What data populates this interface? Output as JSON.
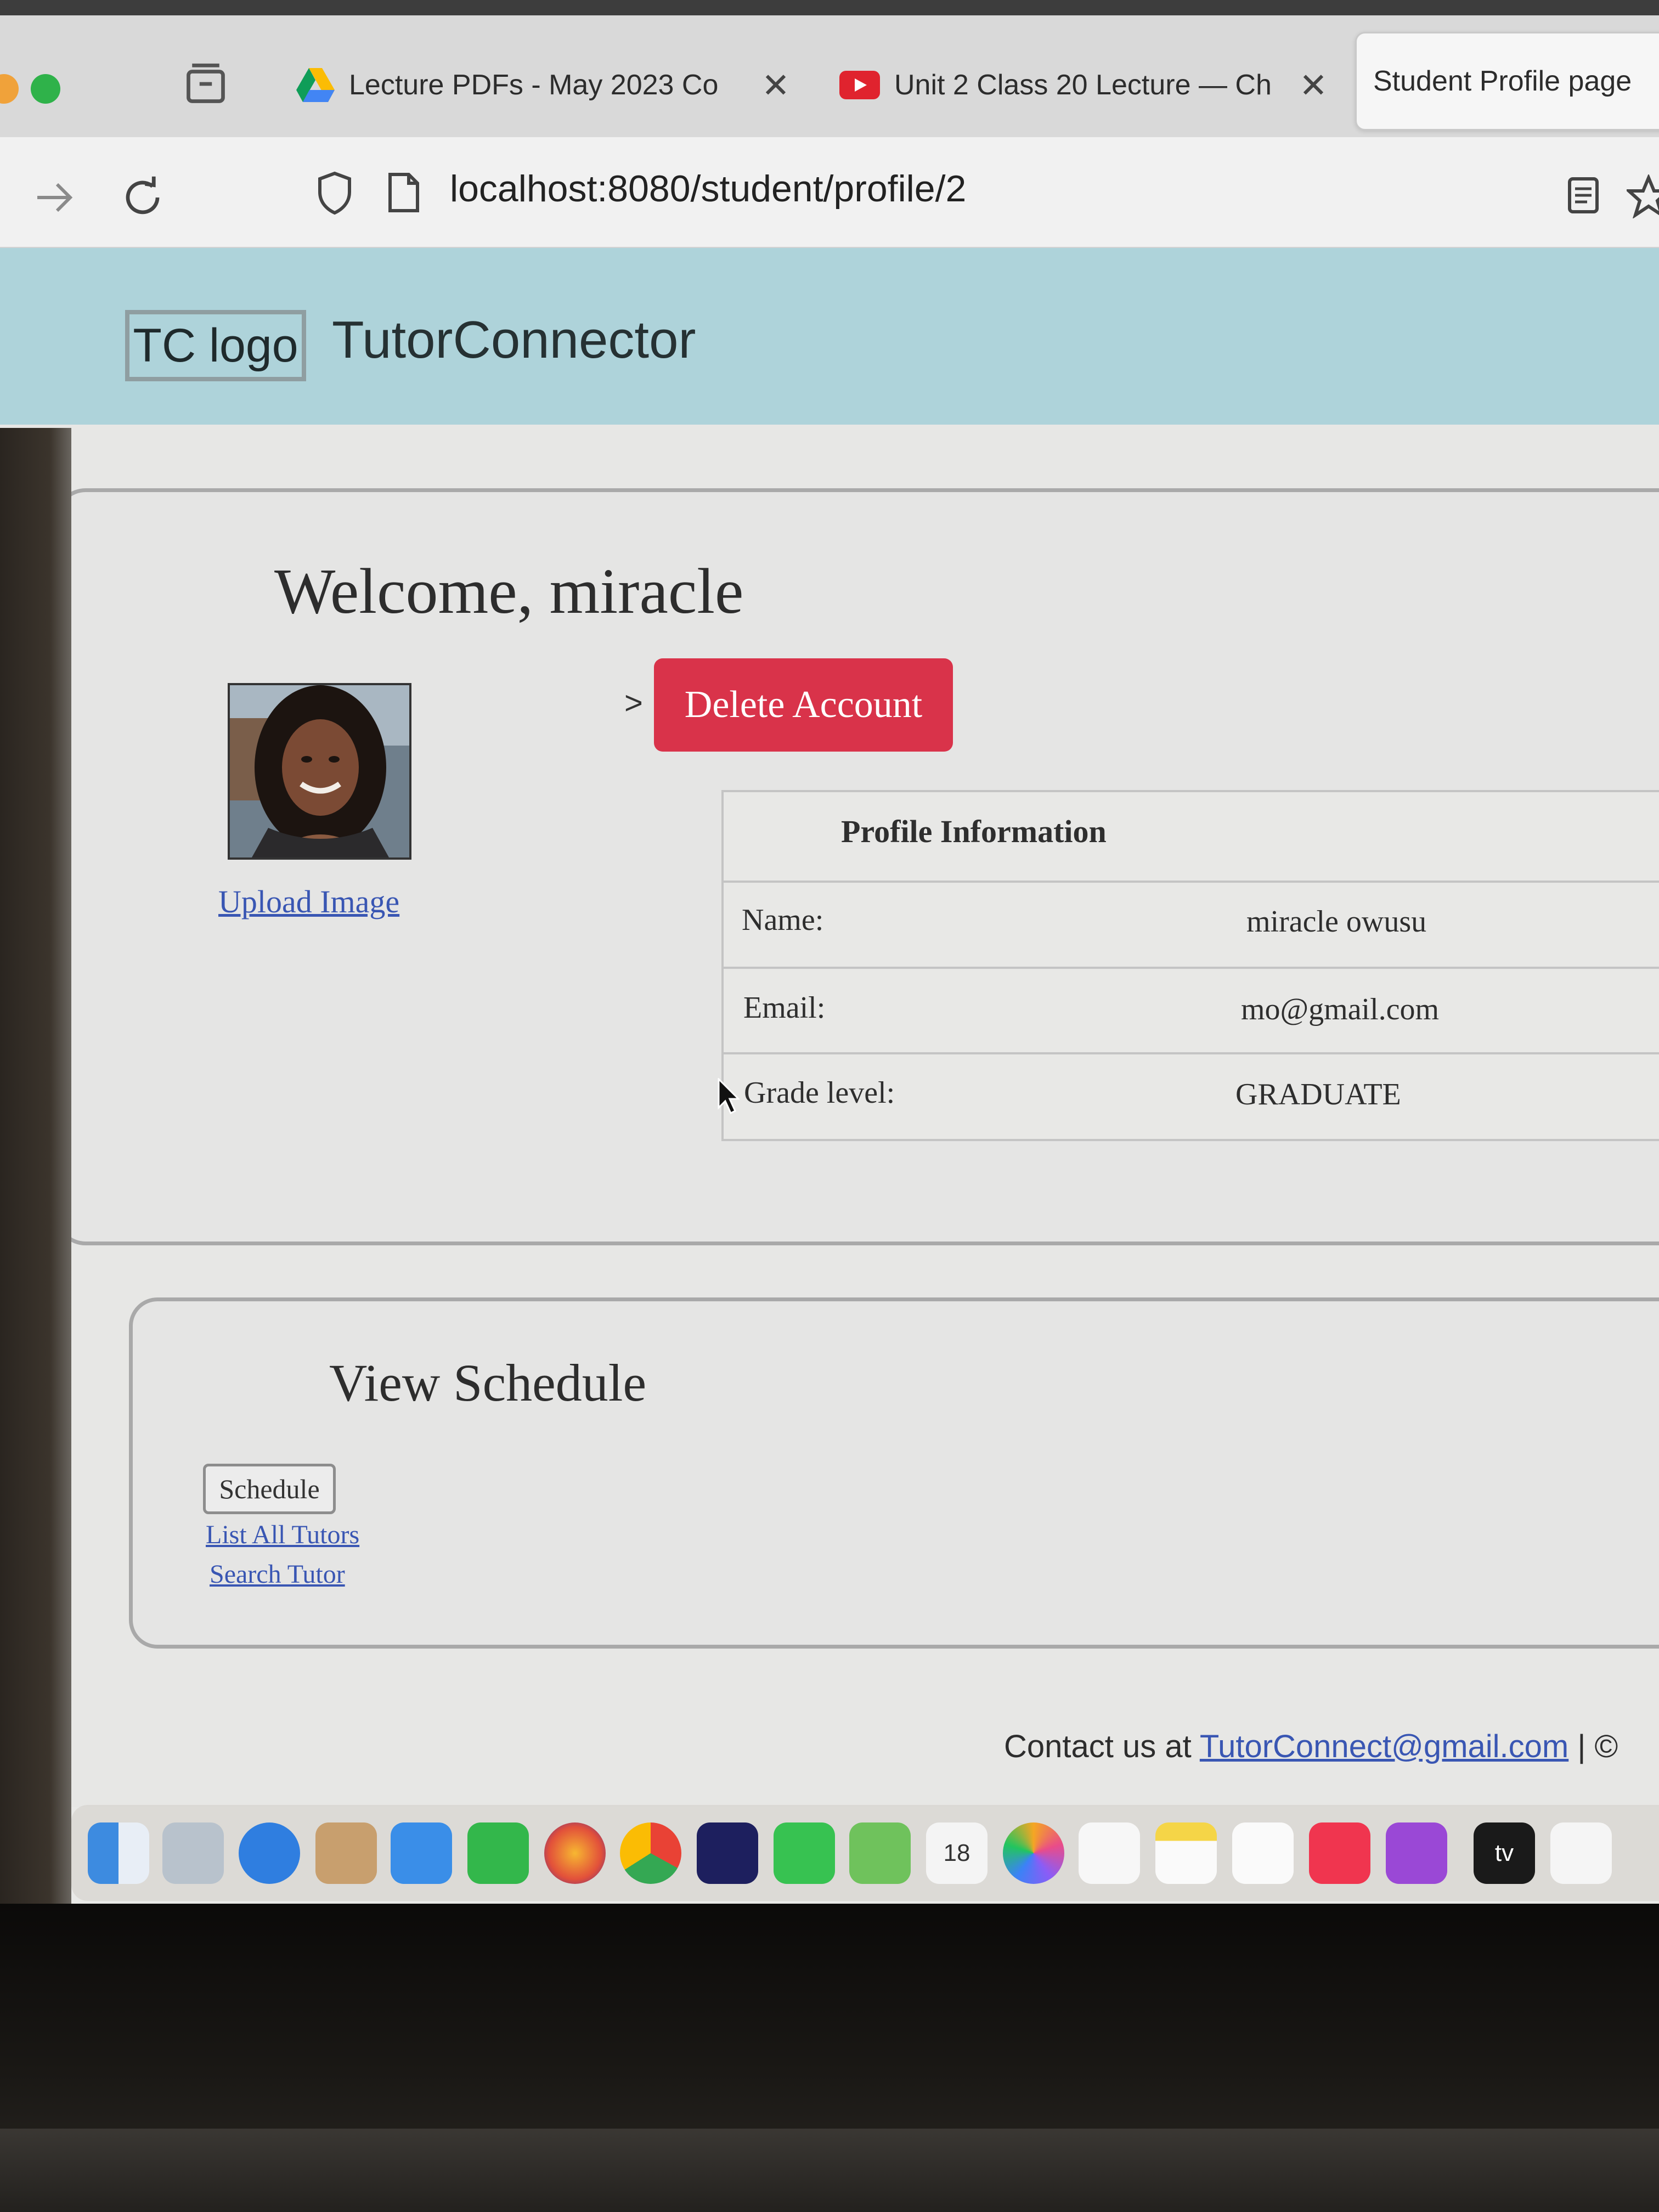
{
  "browser": {
    "tabs": [
      {
        "title": "Lecture PDFs - May 2023 Co",
        "icon": "google-drive-icon"
      },
      {
        "title": "Unit 2 Class 20 Lecture — Ch",
        "icon": "youtube-icon"
      },
      {
        "title": "Student Profile page",
        "icon": ""
      }
    ],
    "tab_close_glyph": "✕",
    "url": "localhost:8080/student/profile/2"
  },
  "app": {
    "logo_text": "TC logo",
    "brand": "TutorConnector",
    "colors": {
      "header": "#aed3da",
      "danger": "#d9334a",
      "link": "#3956b3"
    }
  },
  "profile": {
    "welcome": "Welcome, miracle",
    "upload_link": "Upload Image",
    "breadcrumb_glyph": ">",
    "delete_button": "Delete Account",
    "table_header": "Profile Information",
    "rows": [
      {
        "label": "Name:",
        "value": "miracle owusu"
      },
      {
        "label": "Email:",
        "value": "mo@gmail.com"
      },
      {
        "label": "Grade level:",
        "value": "GRADUATE"
      }
    ]
  },
  "schedule": {
    "title": "View Schedule",
    "button": "Schedule",
    "links": [
      "List All Tutors",
      "Search Tutor"
    ]
  },
  "footer": {
    "prefix": "Contact us at ",
    "email": "TutorConnect@gmail.com",
    "suffix": " | ©"
  },
  "dock": {
    "calendar_day": "18",
    "apps": [
      "finder-icon",
      "launchpad-icon",
      "safari-icon",
      "contacts-icon",
      "mail-icon",
      "facetime-icon",
      "firefox-icon",
      "chrome-icon",
      "intellij-icon",
      "messages-icon",
      "maps-icon",
      "calendar-icon",
      "photos-icon",
      "reminders-icon",
      "notes-icon",
      "freeform-icon",
      "music-icon",
      "podcasts-icon",
      "tv-icon",
      "news-icon"
    ],
    "tv_label": "tv"
  }
}
